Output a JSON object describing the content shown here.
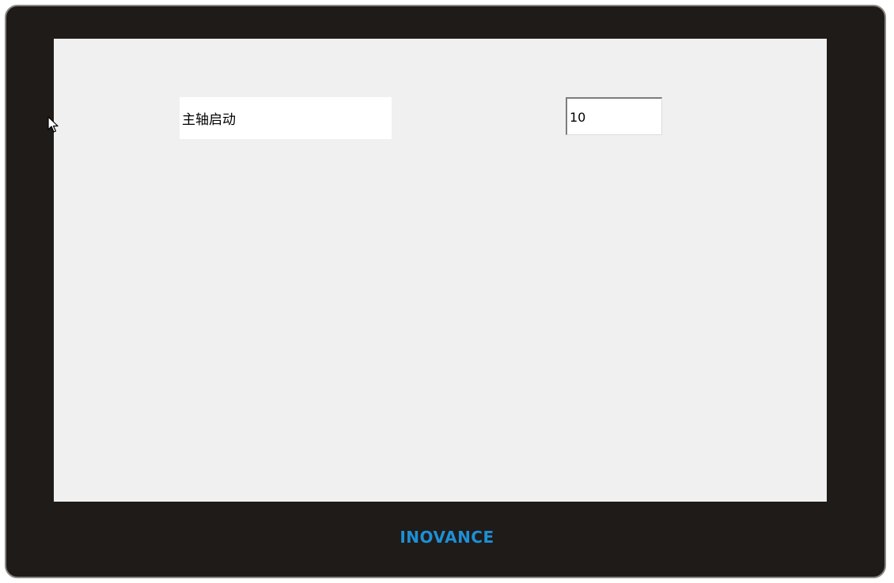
{
  "screen": {
    "label": "主轴启动",
    "value": "10"
  },
  "device": {
    "brand": "INOVANCE",
    "brand_color": "#1e8fd6"
  },
  "icons": {
    "cursor": "mouse-pointer-icon"
  }
}
